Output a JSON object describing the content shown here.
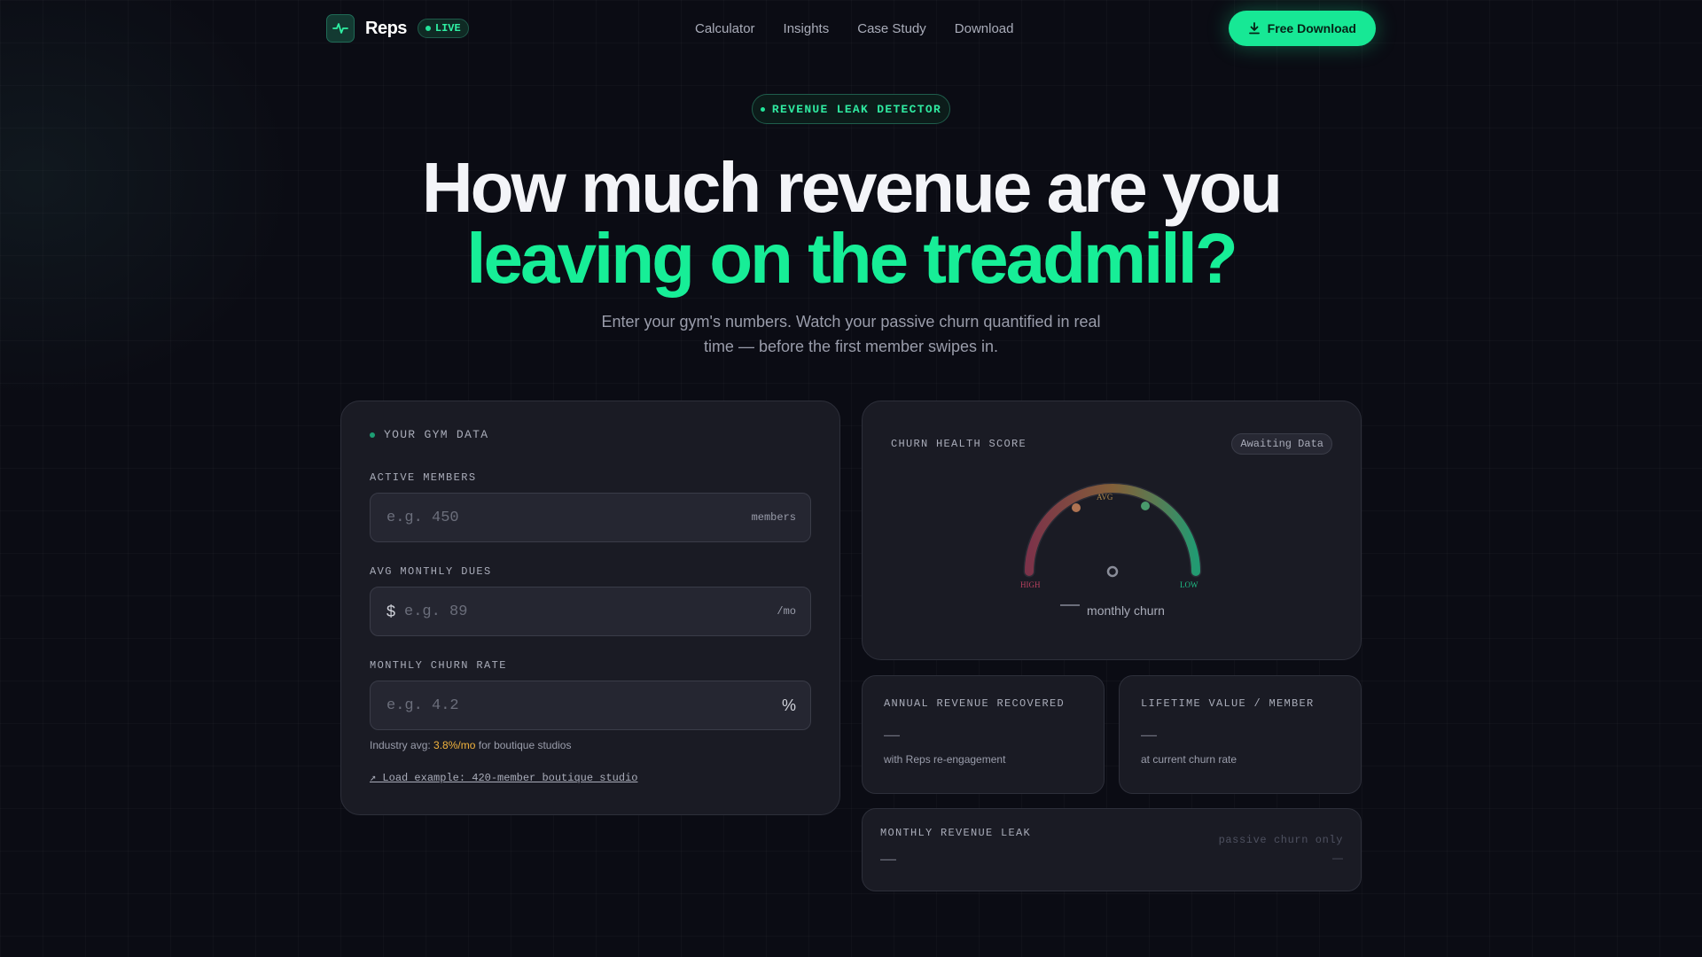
{
  "nav": {
    "brand": "Reps",
    "live_badge": "LIVE",
    "links": [
      "Calculator",
      "Insights",
      "Case Study",
      "Download"
    ],
    "cta_label": "Free Download"
  },
  "hero": {
    "pill": "REVENUE LEAK DETECTOR",
    "title_line1": "How much revenue are you",
    "title_line2": "leaving on the treadmill?",
    "subtitle": "Enter your gym's numbers. Watch your passive churn quantified in real time — before the first member swipes in."
  },
  "gym_data": {
    "section_label": "YOUR GYM DATA",
    "fields": [
      {
        "label": "ACTIVE MEMBERS",
        "placeholder": "e.g. 450",
        "prefix": "",
        "suffix": "members",
        "value": ""
      },
      {
        "label": "AVG MONTHLY DUES",
        "placeholder": "e.g. 89",
        "prefix": "$",
        "suffix": "/mo",
        "value": ""
      },
      {
        "label": "MONTHLY CHURN RATE",
        "placeholder": "e.g. 4.2",
        "prefix": "",
        "suffix": "%",
        "value": ""
      }
    ],
    "hint_prefix": "Industry avg: ",
    "hint_value": "3.8%/mo",
    "hint_suffix": " for boutique studios",
    "example_link": "↗ Load example: 420-member boutique studio"
  },
  "gauge": {
    "title": "CHURN HEALTH SCORE",
    "status": "Awaiting Data",
    "label_high": "HIGH",
    "label_avg": "AVG",
    "label_low": "LOW",
    "readout_label": "monthly churn",
    "colors": {
      "high": "#c0395a",
      "avg": "#c98a3c",
      "low": "#1fbf86"
    }
  },
  "metrics": {
    "annual": {
      "title": "ANNUAL REVENUE RECOVERED",
      "value": "—",
      "note": "with Reps re-engagement"
    },
    "ltv": {
      "title": "LIFETIME VALUE / MEMBER",
      "value": "—",
      "note": "at current churn rate"
    },
    "leak": {
      "title": "MONTHLY REVENUE LEAK",
      "value": "—",
      "side_title": "passive churn only",
      "side_value": "—"
    }
  },
  "accent_color": "#17e895"
}
